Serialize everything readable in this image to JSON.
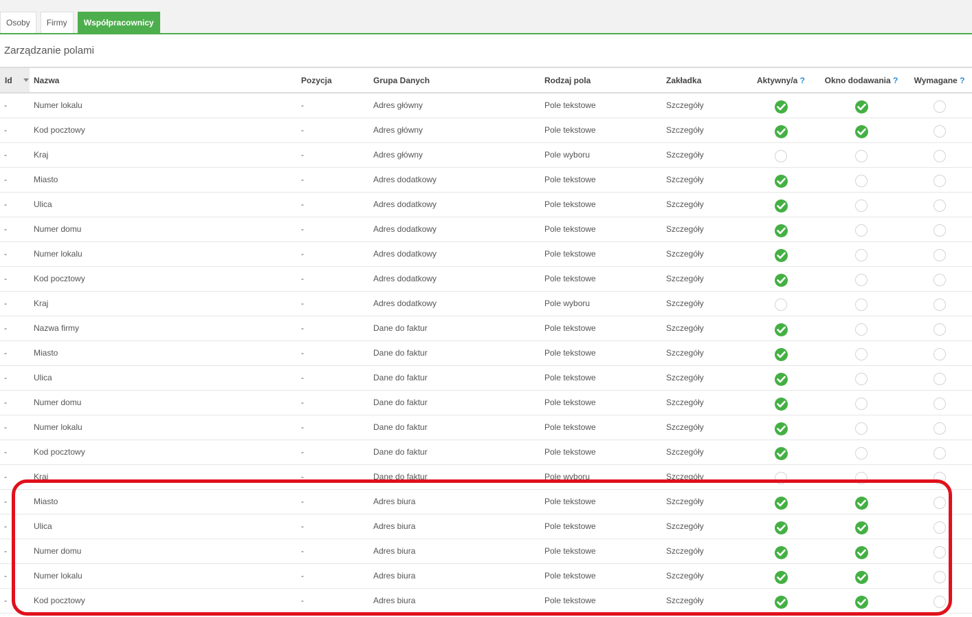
{
  "tabs": [
    {
      "label": "Osoby",
      "active": false
    },
    {
      "label": "Firmy",
      "active": false
    },
    {
      "label": "Współpracownicy",
      "active": true
    }
  ],
  "page_title": "Zarządzanie polami",
  "columns": {
    "id": "Id",
    "name": "Nazwa",
    "position": "Pozycja",
    "group": "Grupa Danych",
    "type": "Rodzaj pola",
    "tab": "Zakładka",
    "active": "Aktywny/a",
    "add_window": "Okno dodawania",
    "required": "Wymagane",
    "help_mark": "?"
  },
  "rows": [
    {
      "id": "-",
      "name": "Numer lokalu",
      "position": "-",
      "group": "Adres główny",
      "type": "Pole tekstowe",
      "tab": "Szczegóły",
      "active": true,
      "add_window": true,
      "required": false
    },
    {
      "id": "-",
      "name": "Kod pocztowy",
      "position": "-",
      "group": "Adres główny",
      "type": "Pole tekstowe",
      "tab": "Szczegóły",
      "active": true,
      "add_window": true,
      "required": false
    },
    {
      "id": "-",
      "name": "Kraj",
      "position": "-",
      "group": "Adres główny",
      "type": "Pole wyboru",
      "tab": "Szczegóły",
      "active": false,
      "add_window": false,
      "required": false
    },
    {
      "id": "-",
      "name": "Miasto",
      "position": "-",
      "group": "Adres dodatkowy",
      "type": "Pole tekstowe",
      "tab": "Szczegóły",
      "active": true,
      "add_window": false,
      "required": false
    },
    {
      "id": "-",
      "name": "Ulica",
      "position": "-",
      "group": "Adres dodatkowy",
      "type": "Pole tekstowe",
      "tab": "Szczegóły",
      "active": true,
      "add_window": false,
      "required": false
    },
    {
      "id": "-",
      "name": "Numer domu",
      "position": "-",
      "group": "Adres dodatkowy",
      "type": "Pole tekstowe",
      "tab": "Szczegóły",
      "active": true,
      "add_window": false,
      "required": false
    },
    {
      "id": "-",
      "name": "Numer lokalu",
      "position": "-",
      "group": "Adres dodatkowy",
      "type": "Pole tekstowe",
      "tab": "Szczegóły",
      "active": true,
      "add_window": false,
      "required": false
    },
    {
      "id": "-",
      "name": "Kod pocztowy",
      "position": "-",
      "group": "Adres dodatkowy",
      "type": "Pole tekstowe",
      "tab": "Szczegóły",
      "active": true,
      "add_window": false,
      "required": false
    },
    {
      "id": "-",
      "name": "Kraj",
      "position": "-",
      "group": "Adres dodatkowy",
      "type": "Pole wyboru",
      "tab": "Szczegóły",
      "active": false,
      "add_window": false,
      "required": false
    },
    {
      "id": "-",
      "name": "Nazwa firmy",
      "position": "-",
      "group": "Dane do faktur",
      "type": "Pole tekstowe",
      "tab": "Szczegóły",
      "active": true,
      "add_window": false,
      "required": false
    },
    {
      "id": "-",
      "name": "Miasto",
      "position": "-",
      "group": "Dane do faktur",
      "type": "Pole tekstowe",
      "tab": "Szczegóły",
      "active": true,
      "add_window": false,
      "required": false
    },
    {
      "id": "-",
      "name": "Ulica",
      "position": "-",
      "group": "Dane do faktur",
      "type": "Pole tekstowe",
      "tab": "Szczegóły",
      "active": true,
      "add_window": false,
      "required": false
    },
    {
      "id": "-",
      "name": "Numer domu",
      "position": "-",
      "group": "Dane do faktur",
      "type": "Pole tekstowe",
      "tab": "Szczegóły",
      "active": true,
      "add_window": false,
      "required": false
    },
    {
      "id": "-",
      "name": "Numer lokalu",
      "position": "-",
      "group": "Dane do faktur",
      "type": "Pole tekstowe",
      "tab": "Szczegóły",
      "active": true,
      "add_window": false,
      "required": false
    },
    {
      "id": "-",
      "name": "Kod pocztowy",
      "position": "-",
      "group": "Dane do faktur",
      "type": "Pole tekstowe",
      "tab": "Szczegóły",
      "active": true,
      "add_window": false,
      "required": false
    },
    {
      "id": "-",
      "name": "Kraj",
      "position": "-",
      "group": "Dane do faktur",
      "type": "Pole wyboru",
      "tab": "Szczegóły",
      "active": false,
      "add_window": false,
      "required": false
    },
    {
      "id": "-",
      "name": "Miasto",
      "position": "-",
      "group": "Adres biura",
      "type": "Pole tekstowe",
      "tab": "Szczegóły",
      "active": true,
      "add_window": true,
      "required": false
    },
    {
      "id": "-",
      "name": "Ulica",
      "position": "-",
      "group": "Adres biura",
      "type": "Pole tekstowe",
      "tab": "Szczegóły",
      "active": true,
      "add_window": true,
      "required": false
    },
    {
      "id": "-",
      "name": "Numer domu",
      "position": "-",
      "group": "Adres biura",
      "type": "Pole tekstowe",
      "tab": "Szczegóły",
      "active": true,
      "add_window": true,
      "required": false
    },
    {
      "id": "-",
      "name": "Numer lokalu",
      "position": "-",
      "group": "Adres biura",
      "type": "Pole tekstowe",
      "tab": "Szczegóły",
      "active": true,
      "add_window": true,
      "required": false
    },
    {
      "id": "-",
      "name": "Kod pocztowy",
      "position": "-",
      "group": "Adres biura",
      "type": "Pole tekstowe",
      "tab": "Szczegóły",
      "active": true,
      "add_window": true,
      "required": false
    }
  ],
  "colors": {
    "accent": "#4cae4c",
    "check": "#44b044",
    "highlight": "#e0111c",
    "help": "#2a8fd6"
  }
}
